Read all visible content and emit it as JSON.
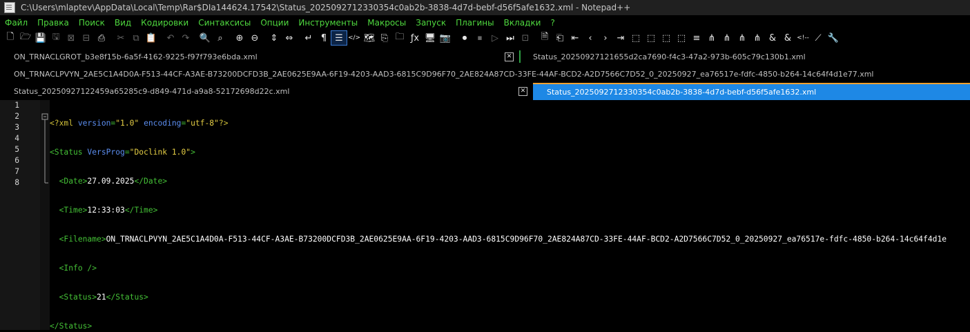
{
  "window": {
    "title": "C:\\Users\\mlaptev\\AppData\\Local\\Temp\\Rar$DIa144624.17542\\Status_2025092712330354c0ab2b-3838-4d7d-bebf-d56f5afe1632.xml - Notepad++"
  },
  "menu": [
    "Файл",
    "Правка",
    "Поиск",
    "Вид",
    "Кодировки",
    "Синтаксисы",
    "Опции",
    "Инструменты",
    "Макросы",
    "Запуск",
    "Плагины",
    "Вкладки",
    "?"
  ],
  "toolbar": [
    {
      "name": "new-file-icon",
      "glyph": "🗋"
    },
    {
      "name": "open-file-icon",
      "glyph": "🗁"
    },
    {
      "name": "save-icon",
      "glyph": "💾",
      "disabled": true
    },
    {
      "name": "save-all-icon",
      "glyph": "🖫",
      "disabled": true
    },
    {
      "name": "close-icon",
      "glyph": "⊠",
      "disabled": true
    },
    {
      "name": "close-all-icon",
      "glyph": "⊟",
      "disabled": true
    },
    {
      "name": "print-icon",
      "glyph": "⎙"
    },
    {
      "name": "sep"
    },
    {
      "name": "cut-icon",
      "glyph": "✂",
      "disabled": true
    },
    {
      "name": "copy-icon",
      "glyph": "⧉",
      "disabled": true
    },
    {
      "name": "paste-icon",
      "glyph": "📋"
    },
    {
      "name": "sep"
    },
    {
      "name": "undo-icon",
      "glyph": "↶",
      "disabled": true
    },
    {
      "name": "redo-icon",
      "glyph": "↷",
      "disabled": true
    },
    {
      "name": "sep"
    },
    {
      "name": "find-icon",
      "glyph": "🔍"
    },
    {
      "name": "replace-icon",
      "glyph": "⌕"
    },
    {
      "name": "sep"
    },
    {
      "name": "zoom-in-icon",
      "glyph": "⊕"
    },
    {
      "name": "zoom-out-icon",
      "glyph": "⊖"
    },
    {
      "name": "sep"
    },
    {
      "name": "sync-vertical-icon",
      "glyph": "⇕"
    },
    {
      "name": "sync-horizontal-icon",
      "glyph": "⇔"
    },
    {
      "name": "sep"
    },
    {
      "name": "word-wrap-icon",
      "glyph": "↵"
    },
    {
      "name": "show-all-chars-icon",
      "glyph": "¶"
    },
    {
      "name": "indent-guide-icon",
      "glyph": "☰",
      "selected": true
    },
    {
      "name": "xml-icon",
      "glyph": "</>"
    },
    {
      "name": "document-map-icon",
      "glyph": "🗺"
    },
    {
      "name": "function-list-icon",
      "glyph": "⎘"
    },
    {
      "name": "folder-workspace-icon",
      "glyph": "🗀"
    },
    {
      "name": "fx-icon",
      "glyph": "ƒx"
    },
    {
      "name": "monitor-icon",
      "glyph": "🖥"
    },
    {
      "name": "screenshot-icon",
      "glyph": "📷"
    },
    {
      "name": "sep"
    },
    {
      "name": "record-macro-icon",
      "glyph": "⏺"
    },
    {
      "name": "stop-macro-icon",
      "glyph": "⏹",
      "disabled": true
    },
    {
      "name": "play-macro-icon",
      "glyph": "▷",
      "disabled": true
    },
    {
      "name": "run-macro-multiple-icon",
      "glyph": "⏭"
    },
    {
      "name": "save-macro-icon",
      "glyph": "⊡",
      "disabled": true
    },
    {
      "name": "sep"
    },
    {
      "name": "doc-icon",
      "glyph": "🗎"
    },
    {
      "name": "doc-switch-icon",
      "glyph": "⎗"
    },
    {
      "name": "first-icon",
      "glyph": "⇤"
    },
    {
      "name": "prev-icon",
      "glyph": "‹"
    },
    {
      "name": "next-icon",
      "glyph": "›"
    },
    {
      "name": "last-icon",
      "glyph": "⇥"
    },
    {
      "name": "plugin-a-icon",
      "glyph": "⬚"
    },
    {
      "name": "plugin-b-icon",
      "glyph": "⬚"
    },
    {
      "name": "plugin-c-icon",
      "glyph": "⬚"
    },
    {
      "name": "plugin-d-icon",
      "glyph": "⬚"
    },
    {
      "name": "plugin-e-icon",
      "glyph": "≡"
    },
    {
      "name": "tree-a-icon",
      "glyph": "⋔"
    },
    {
      "name": "tree-b-icon",
      "glyph": "⋔"
    },
    {
      "name": "tree-c-icon",
      "glyph": "⋔"
    },
    {
      "name": "tree-d-icon",
      "glyph": "⋔"
    },
    {
      "name": "ampersand-icon",
      "glyph": "&"
    },
    {
      "name": "ampersand-strike-icon",
      "glyph": "&"
    },
    {
      "name": "comment-icon",
      "glyph": "<!--"
    },
    {
      "name": "uncomment-icon",
      "glyph": "⟋"
    },
    {
      "name": "wrench-icon",
      "glyph": "🔧"
    }
  ],
  "tabs": {
    "row1_left": "ON_TRNACLGROT_b3e8f15b-6a5f-4162-9225-f97f793e6bda.xml",
    "row1_right": "Status_20250927121655d2ca7690-f4c3-47a2-973b-605c79c130b1.xml",
    "row2": "ON_TRNACLPVYN_2AE5C1A4D0A-F513-44CF-A3AE-B73200DCFD3B_2AE0625E9AA-6F19-4203-AAD3-6815C9D96F70_2AE824A87CD-33FE-44AF-BCD2-A2D7566C7D52_0_20250927_ea76517e-fdfc-4850-b264-14c64f4d1e77.xml",
    "row3_left": "Status_20250927122459a65285c9-d849-471d-a9a8-52172698d22c.xml",
    "row3_active": "Status_2025092712330354c0ab2b-3838-4d7d-bebf-d56f5afe1632.xml",
    "close_glyph": "✕"
  },
  "editor": {
    "line_numbers": [
      "1",
      "2",
      "3",
      "4",
      "5",
      "6",
      "7",
      "8"
    ],
    "decl": {
      "open": "<?xml ",
      "v_attr": "version",
      "v_val": "\"1.0\"",
      "e_attr": "encoding",
      "e_val": "\"utf-8\"",
      "close": "?>"
    },
    "status_open": {
      "open": "<Status ",
      "attr": "VersProg",
      "val": "\"Doclink 1.0\"",
      "close": ">"
    },
    "date": {
      "open": "<Date>",
      "value": "27.09.2025",
      "close": "</Date>"
    },
    "time": {
      "open": "<Time>",
      "value": "12:33:03",
      "close": "</Time>"
    },
    "filename": {
      "open": "<Filename>",
      "value": "ON_TRNACLPVYN_2AE5C1A4D0A-F513-44CF-A3AE-B73200DCFD3B_2AE0625E9AA-6F19-4203-AAD3-6815C9D96F70_2AE824A87CD-33FE-44AF-BCD2-A2D7566C7D52_0_20250927_ea76517e-fdfc-4850-b264-14c64f4d1e"
    },
    "info": "<Info />",
    "status_val": {
      "open": "<Status>",
      "value": "21",
      "close": "</Status>"
    },
    "status_close": "</Status>",
    "equals": "="
  }
}
